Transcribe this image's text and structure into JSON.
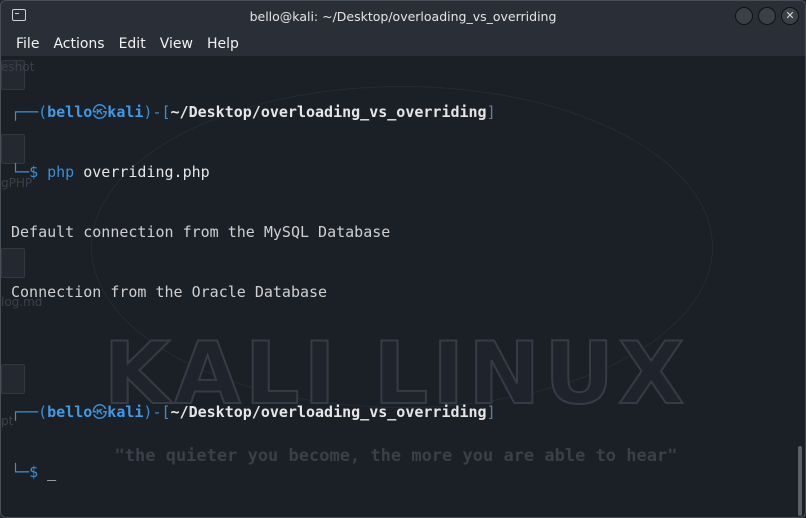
{
  "window": {
    "title": "bello@kali: ~/Desktop/overloading_vs_overriding"
  },
  "menu": {
    "items": [
      "File",
      "Actions",
      "Edit",
      "View",
      "Help"
    ]
  },
  "prompt": {
    "open_corner": "┌──(",
    "user": "bello",
    "separator": "㉿",
    "host": "kali",
    "close_corner": ")-[",
    "path": "~/Desktop/overloading_vs_overriding",
    "close_bracket": "]",
    "second_corner": "└─",
    "dollar": "$"
  },
  "session": {
    "command_kw": "php",
    "command_arg": "overriding.php",
    "output": [
      "Default connection from the MySQL Database",
      "Connection from the Oracle Database"
    ],
    "cursor": "_"
  },
  "wallpaper": {
    "logo": "KALI LINUX",
    "motto": "\"the quieter you become, the more you are able to hear\""
  },
  "desktop_ghost_labels": [
    "eshot",
    "gPHP",
    "log.md",
    "pt"
  ]
}
